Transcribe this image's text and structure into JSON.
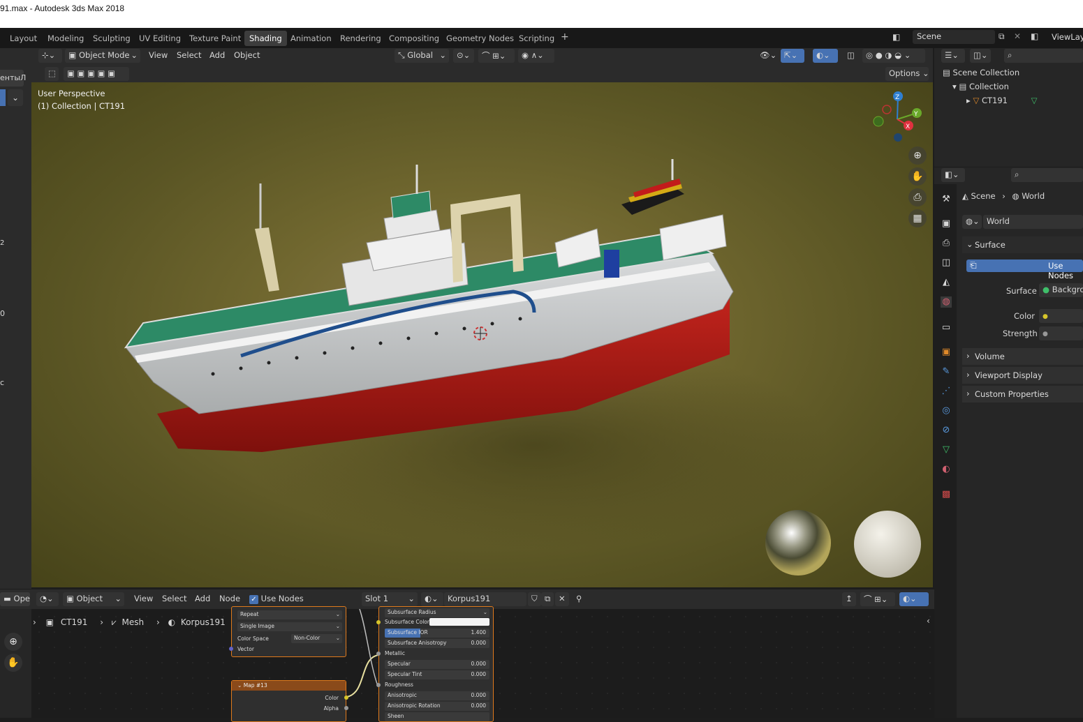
{
  "window": {
    "title": "91.max - Autodesk 3ds Max 2018"
  },
  "workspaces": {
    "tabs": [
      "Layout",
      "Modeling",
      "Sculpting",
      "UV Editing",
      "Texture Paint",
      "Shading",
      "Animation",
      "Rendering",
      "Compositing",
      "Geometry Nodes",
      "Scripting"
    ],
    "active": "Shading",
    "add": "+",
    "scene_name": "Scene",
    "view_layer": "ViewLay"
  },
  "left_partial": {
    "label": "ентыЛ",
    "side_chars": [
      "2",
      "0",
      "c"
    ]
  },
  "viewport_header": {
    "mode": "Object Mode",
    "menus": [
      "View",
      "Select",
      "Add",
      "Object"
    ],
    "transform": "Global",
    "options": "Options"
  },
  "viewport": {
    "perspective": "User Perspective",
    "collection_info": "(1) Collection | CT191",
    "gizmo_axes": {
      "z": "Z",
      "y": "Y",
      "x": "X"
    },
    "colors": {
      "x": "#e0313f",
      "y": "#6aa82a",
      "z": "#2f7fd1"
    }
  },
  "outliner": {
    "search_placeholder": "",
    "scene_collection": "Scene Collection",
    "collection": "Collection",
    "object": "CT191"
  },
  "properties": {
    "breadcrumb": {
      "scene": "Scene",
      "world": "World"
    },
    "world_name": "World",
    "panel_surface": "Surface",
    "use_nodes": "Use Nodes",
    "surface_label": "Surface",
    "surface_value": "Backgro",
    "color_label": "Color",
    "strength_label": "Strength",
    "panels_collapsed": [
      "Volume",
      "Viewport Display",
      "Custom Properties"
    ],
    "accent": "#4772b3"
  },
  "node_editor_header": {
    "editor_left": "Ope",
    "object_mode": "Object",
    "menus": [
      "View",
      "Select",
      "Add",
      "Node"
    ],
    "use_nodes": "Use Nodes",
    "slot": "Slot 1",
    "material": "Korpus191"
  },
  "node_breadcrumb": {
    "object": "CT191",
    "mesh": "Mesh",
    "material": "Korpus191"
  },
  "image_node": {
    "extension": "Repeat",
    "projection": "Single Image",
    "color_space_label": "Color Space",
    "color_space_value": "Non-Color",
    "vector": "Vector"
  },
  "map_node": {
    "title": "Map #13",
    "outputs": [
      "Color",
      "Alpha"
    ]
  },
  "bsdf_node": {
    "subsurface_radius": "Subsurface Radius",
    "subsurface_color": "Subsurface Color",
    "fields": [
      {
        "label": "Subsurface IOR",
        "value": "1.400"
      },
      {
        "label": "Subsurface Anisotropy",
        "value": "0.000"
      }
    ],
    "metallic": "Metallic",
    "fields2": [
      {
        "label": "Specular",
        "value": "0.000"
      },
      {
        "label": "Specular Tint",
        "value": "0.000"
      }
    ],
    "roughness": "Roughness",
    "fields3": [
      {
        "label": "Anisotropic",
        "value": "0.000"
      },
      {
        "label": "Anisotropic Rotation",
        "value": "0.000"
      }
    ],
    "last": "Sheen"
  }
}
